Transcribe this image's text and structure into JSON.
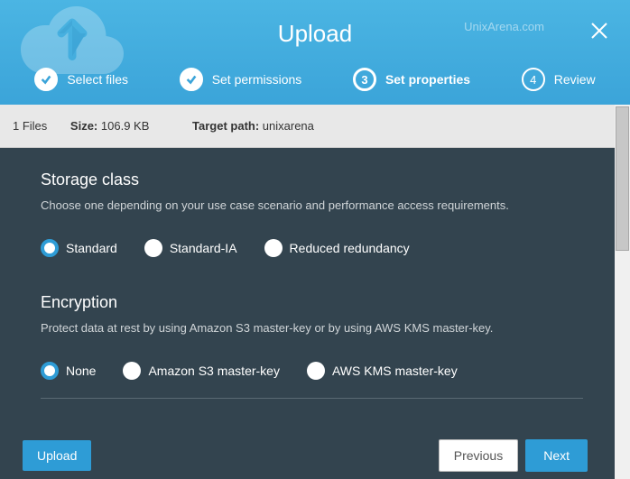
{
  "header": {
    "title": "Upload",
    "watermark": "UnixArena.com"
  },
  "steps": [
    {
      "label": "Select files",
      "completed": true
    },
    {
      "label": "Set permissions",
      "completed": true
    },
    {
      "label": "Set properties",
      "number": "3",
      "active": true
    },
    {
      "label": "Review",
      "number": "4"
    }
  ],
  "info_bar": {
    "files_count": "1 Files",
    "size_label": "Size:",
    "size_value": "106.9 KB",
    "target_label": "Target path:",
    "target_value": "unixarena"
  },
  "storage": {
    "title": "Storage class",
    "desc": "Choose one depending on your use case scenario and performance access requirements.",
    "options": [
      {
        "label": "Standard",
        "selected": true
      },
      {
        "label": "Standard-IA",
        "selected": false
      },
      {
        "label": "Reduced redundancy",
        "selected": false
      }
    ]
  },
  "encryption": {
    "title": "Encryption",
    "desc": "Protect data at rest by using Amazon S3 master-key or by using AWS KMS master-key.",
    "options": [
      {
        "label": "None",
        "selected": true
      },
      {
        "label": "Amazon S3 master-key",
        "selected": false
      },
      {
        "label": "AWS KMS master-key",
        "selected": false
      }
    ]
  },
  "footer": {
    "upload": "Upload",
    "previous": "Previous",
    "next": "Next"
  }
}
